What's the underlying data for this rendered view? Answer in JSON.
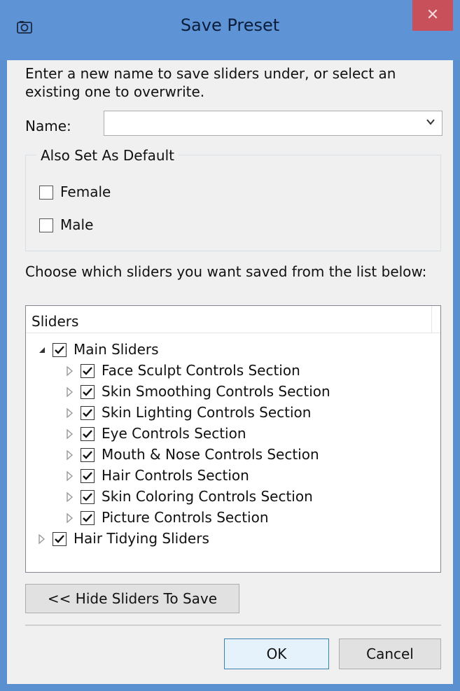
{
  "window": {
    "title": "Save Preset",
    "icon": "camera-icon",
    "close_glyph": "✕"
  },
  "intro_text": "Enter a new name to save sliders under, or select an existing one to overwrite.",
  "name_field": {
    "label": "Name:",
    "value": "",
    "icon": "chevron-down-icon"
  },
  "default_group": {
    "legend": "Also Set As Default",
    "options": [
      {
        "label": "Female",
        "checked": false
      },
      {
        "label": "Male",
        "checked": false
      }
    ]
  },
  "choose_text": "Choose which sliders you want saved from the list below:",
  "tree": {
    "header": "Sliders",
    "nodes": [
      {
        "label": "Main Sliders",
        "checked": true,
        "expanded": true,
        "level": 0
      },
      {
        "label": "Face Sculpt Controls Section",
        "checked": true,
        "expanded": false,
        "level": 1
      },
      {
        "label": "Skin Smoothing Controls Section",
        "checked": true,
        "expanded": false,
        "level": 1
      },
      {
        "label": "Skin Lighting Controls Section",
        "checked": true,
        "expanded": false,
        "level": 1
      },
      {
        "label": "Eye Controls Section",
        "checked": true,
        "expanded": false,
        "level": 1
      },
      {
        "label": "Mouth & Nose Controls Section",
        "checked": true,
        "expanded": false,
        "level": 1
      },
      {
        "label": "Hair Controls Section",
        "checked": true,
        "expanded": false,
        "level": 1
      },
      {
        "label": "Skin Coloring Controls Section",
        "checked": true,
        "expanded": false,
        "level": 1
      },
      {
        "label": "Picture Controls Section",
        "checked": true,
        "expanded": false,
        "level": 1
      },
      {
        "label": "Hair Tidying Sliders",
        "checked": true,
        "expanded": false,
        "level": 0
      }
    ]
  },
  "buttons": {
    "hide": "<< Hide Sliders To Save",
    "ok": "OK",
    "cancel": "Cancel"
  }
}
